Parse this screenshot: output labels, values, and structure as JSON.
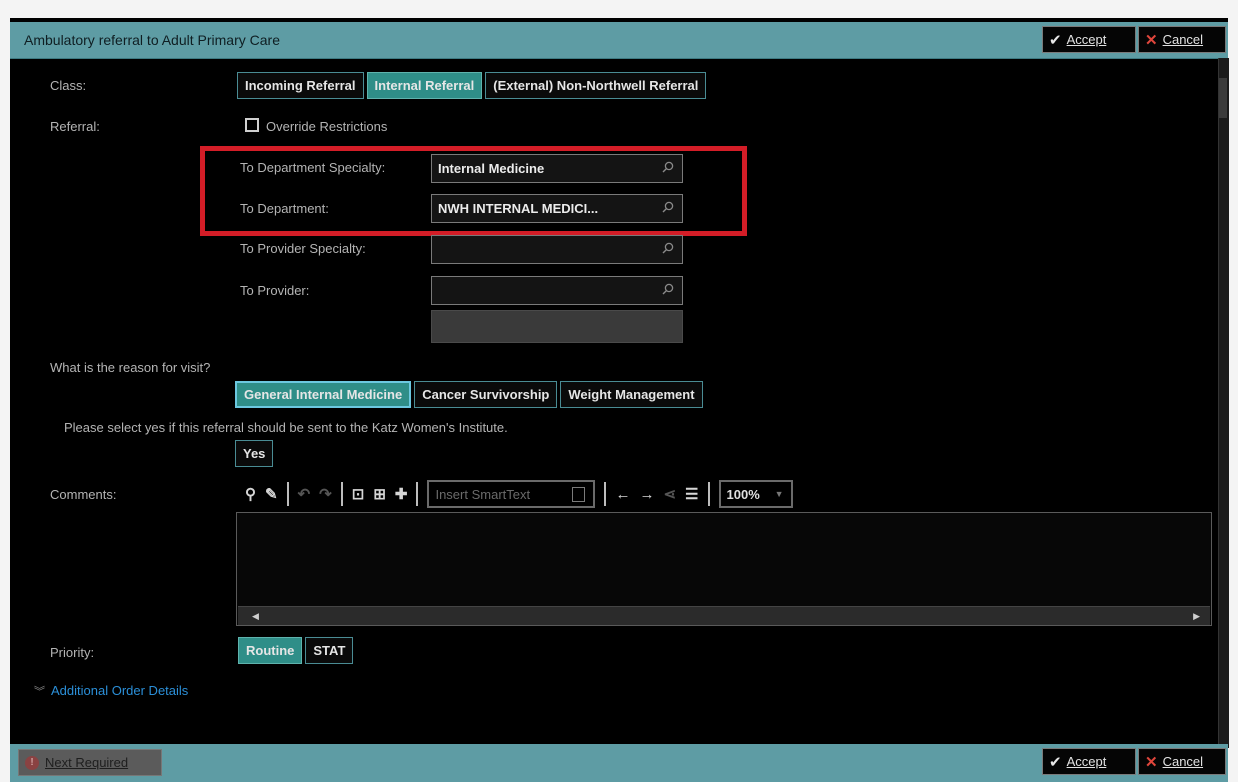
{
  "window": {
    "title": "Ambulatory referral to Adult Primary Care"
  },
  "header_buttons": {
    "accept": "Accept",
    "cancel": "Cancel"
  },
  "class": {
    "label": "Class:",
    "options": [
      "Incoming Referral",
      "Internal Referral",
      "(External) Non-Northwell Referral"
    ],
    "selected": "Internal Referral"
  },
  "referral": {
    "label": "Referral:",
    "override_label": "Override Restrictions",
    "override_checked": false,
    "dept_specialty_label": "To Department Specialty:",
    "dept_specialty_value": "Internal Medicine",
    "department_label": "To Department:",
    "department_value": "NWH INTERNAL MEDICI...",
    "provider_specialty_label": "To Provider Specialty:",
    "provider_specialty_value": "",
    "provider_label": "To Provider:",
    "provider_value": ""
  },
  "reason": {
    "label": "What is the reason for visit?",
    "options": [
      "General Internal Medicine",
      "Cancer Survivorship",
      "Weight Management"
    ],
    "selected": "General Internal Medicine"
  },
  "katz": {
    "question": "Please select yes if this referral should be sent to the Katz Women's Institute.",
    "yes_label": "Yes"
  },
  "comments": {
    "label": "Comments:",
    "smarttext_placeholder": "Insert SmartText",
    "zoom": "100%"
  },
  "priority": {
    "label": "Priority:",
    "options": [
      "Routine",
      "STAT"
    ],
    "selected": "Routine"
  },
  "additional_details": "Additional Order Details",
  "footer": {
    "next_required": "Next Required",
    "accept": "Accept",
    "cancel": "Cancel"
  },
  "colors": {
    "header_teal": "#5e9ca4",
    "selected_teal": "#2f8e88",
    "highlight_red": "#d31d27",
    "link_blue": "#2b8fd8"
  }
}
